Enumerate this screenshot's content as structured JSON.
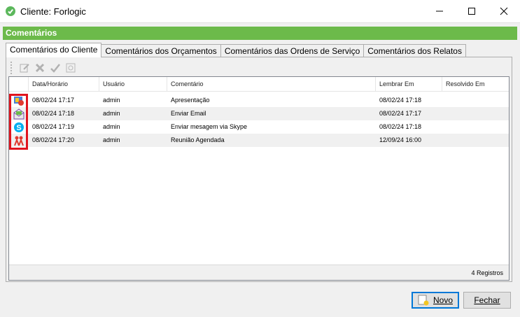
{
  "window": {
    "title": "Cliente: Forlogic"
  },
  "section_header": "Comentários",
  "tabs": [
    {
      "label": "Comentários do Cliente",
      "active": true
    },
    {
      "label": "Comentários dos Orçamentos",
      "active": false
    },
    {
      "label": "Comentários das Ordens de Serviço",
      "active": false
    },
    {
      "label": "Comentários dos Relatos",
      "active": false
    }
  ],
  "toolbar": {
    "icons": [
      "edit-icon",
      "delete-icon",
      "resolve-check-icon",
      "preview-icon"
    ]
  },
  "grid": {
    "columns": [
      "Data/Horário",
      "Usuário",
      "Comentário",
      "Lembrar Em",
      "Resolvido Em"
    ],
    "rows": [
      {
        "icon": "presentation-icon",
        "datetime": "08/02/24 17:17",
        "user": "admin",
        "comment": "Apresentação",
        "remind": "08/02/24 17:18",
        "resolved": ""
      },
      {
        "icon": "email-icon",
        "datetime": "08/02/24 17:18",
        "user": "admin",
        "comment": "Enviar Email",
        "remind": "08/02/24 17:17",
        "resolved": ""
      },
      {
        "icon": "skype-icon",
        "datetime": "08/02/24 17:19",
        "user": "admin",
        "comment": "Enviar mesagem via Skype",
        "remind": "08/02/24 17:18",
        "resolved": ""
      },
      {
        "icon": "meeting-icon",
        "datetime": "08/02/24 17:20",
        "user": "admin",
        "comment": "Reunião Agendada",
        "remind": "12/09/24 16:00",
        "resolved": ""
      }
    ],
    "footer": "4 Registros"
  },
  "buttons": {
    "new": "Novo",
    "close": "Fechar"
  }
}
